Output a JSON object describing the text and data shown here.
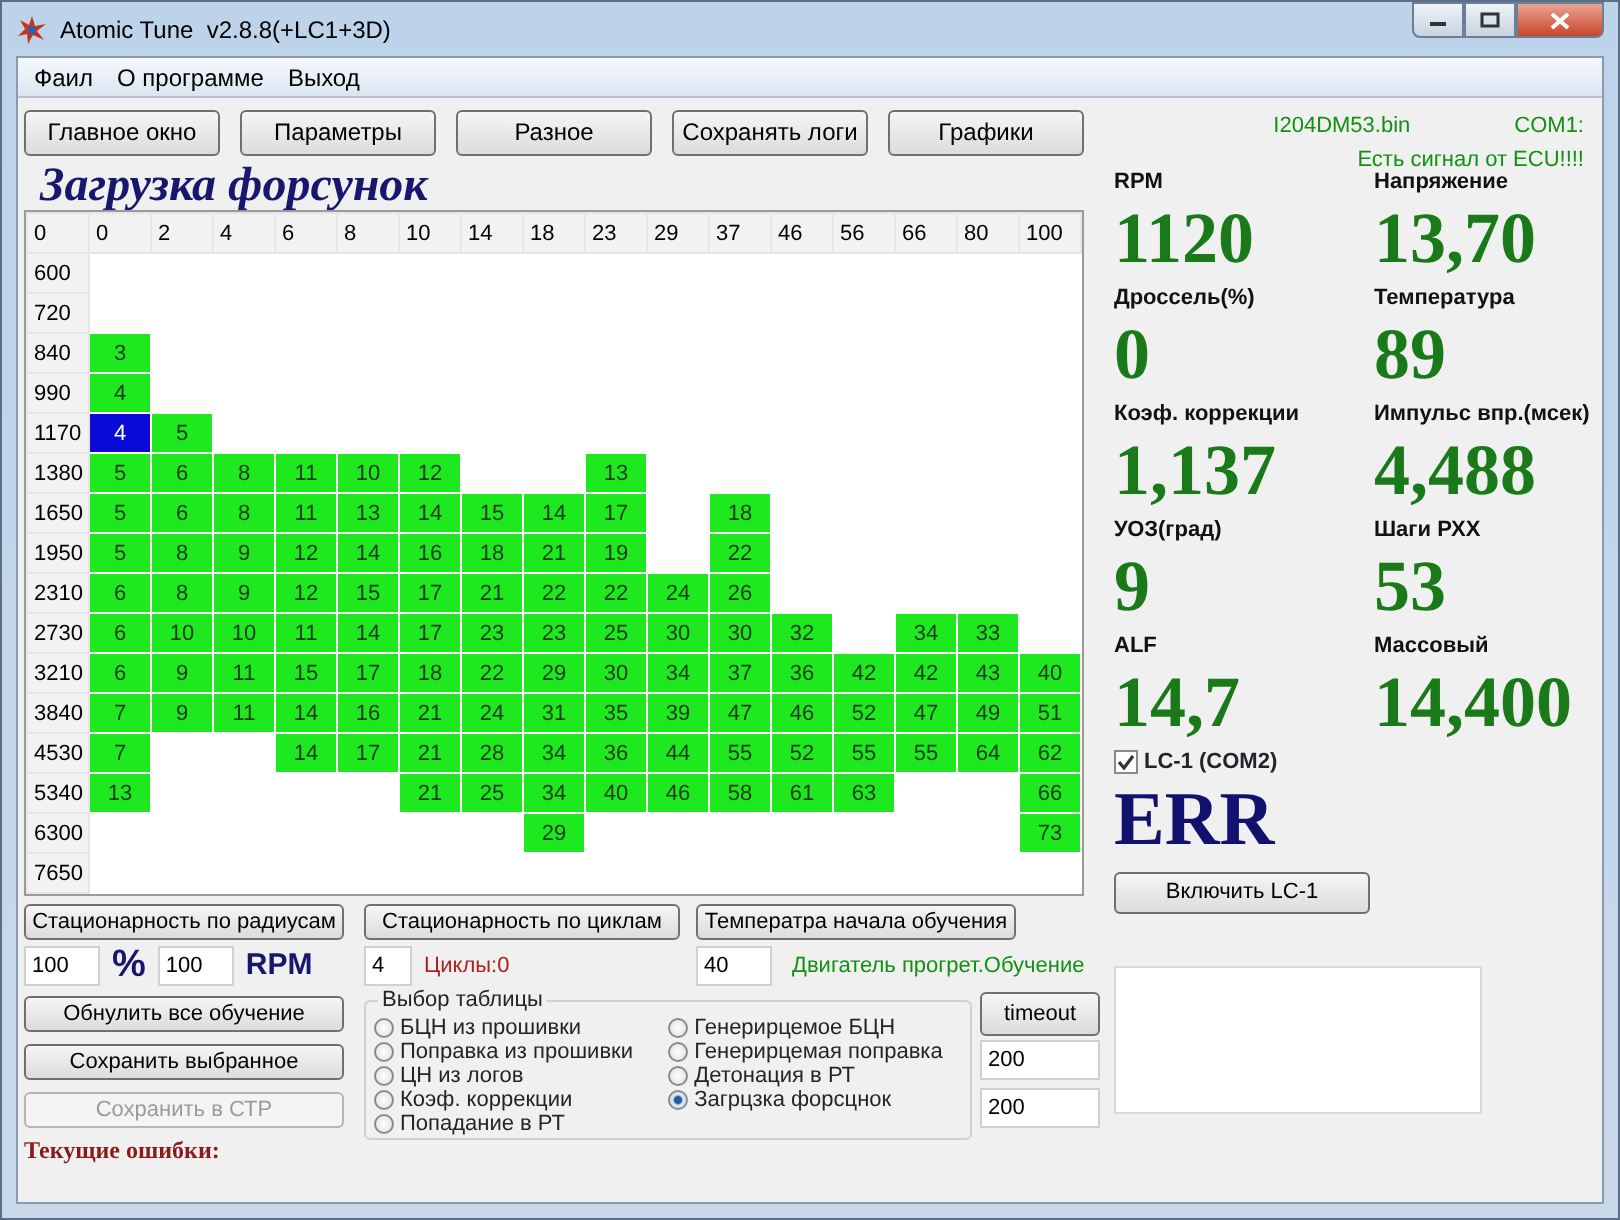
{
  "window": {
    "title": "Atomic Tune  v2.8.8(+LC1+3D)"
  },
  "menu": [
    "Фаил",
    "О программе",
    "Выход"
  ],
  "toolbar": [
    "Главное окно",
    "Параметры",
    "Разное",
    "Сохранять логи",
    "Графики"
  ],
  "file_name": "I204DM53.bin",
  "port": "COM1:",
  "signal_status": "Есть сигнал от ECU!!!!",
  "heading": "Загрузка форсунок",
  "table": {
    "corner": "0",
    "columns": [
      "0",
      "2",
      "4",
      "6",
      "8",
      "10",
      "14",
      "18",
      "23",
      "29",
      "37",
      "46",
      "56",
      "66",
      "80",
      "100"
    ],
    "rows": [
      {
        "rpm": "600",
        "cells": [
          null,
          null,
          null,
          null,
          null,
          null,
          null,
          null,
          null,
          null,
          null,
          null,
          null,
          null,
          null,
          null
        ]
      },
      {
        "rpm": "720",
        "cells": [
          null,
          null,
          null,
          null,
          null,
          null,
          null,
          null,
          null,
          null,
          null,
          null,
          null,
          null,
          null,
          null
        ]
      },
      {
        "rpm": "840",
        "cells": [
          {
            "v": "3",
            "selected": false
          },
          null,
          null,
          null,
          null,
          null,
          null,
          null,
          null,
          null,
          null,
          null,
          null,
          null,
          null,
          null
        ]
      },
      {
        "rpm": "990",
        "cells": [
          {
            "v": "4",
            "selected": false
          },
          null,
          null,
          null,
          null,
          null,
          null,
          null,
          null,
          null,
          null,
          null,
          null,
          null,
          null,
          null
        ]
      },
      {
        "rpm": "1170",
        "cells": [
          {
            "v": "4",
            "selected": true
          },
          {
            "v": "5",
            "selected": false
          },
          null,
          null,
          null,
          null,
          null,
          null,
          null,
          null,
          null,
          null,
          null,
          null,
          null,
          null
        ]
      },
      {
        "rpm": "1380",
        "cells": [
          {
            "v": "5",
            "selected": false
          },
          {
            "v": "6",
            "selected": false
          },
          {
            "v": "8",
            "selected": false
          },
          {
            "v": "11",
            "selected": false
          },
          {
            "v": "10",
            "selected": false
          },
          {
            "v": "12",
            "selected": false
          },
          null,
          null,
          {
            "v": "13",
            "selected": false
          },
          null,
          null,
          null,
          null,
          null,
          null,
          null
        ]
      },
      {
        "rpm": "1650",
        "cells": [
          {
            "v": "5",
            "selected": false
          },
          {
            "v": "6",
            "selected": false
          },
          {
            "v": "8",
            "selected": false
          },
          {
            "v": "11",
            "selected": false
          },
          {
            "v": "13",
            "selected": false
          },
          {
            "v": "14",
            "selected": false
          },
          {
            "v": "15",
            "selected": false
          },
          {
            "v": "14",
            "selected": false
          },
          {
            "v": "17",
            "selected": false
          },
          null,
          {
            "v": "18",
            "selected": false
          },
          null,
          null,
          null,
          null,
          null
        ]
      },
      {
        "rpm": "1950",
        "cells": [
          {
            "v": "5",
            "selected": false
          },
          {
            "v": "8",
            "selected": false
          },
          {
            "v": "9",
            "selected": false
          },
          {
            "v": "12",
            "selected": false
          },
          {
            "v": "14",
            "selected": false
          },
          {
            "v": "16",
            "selected": false
          },
          {
            "v": "18",
            "selected": false
          },
          {
            "v": "21",
            "selected": false
          },
          {
            "v": "19",
            "selected": false
          },
          null,
          {
            "v": "22",
            "selected": false
          },
          null,
          null,
          null,
          null,
          null
        ]
      },
      {
        "rpm": "2310",
        "cells": [
          {
            "v": "6",
            "selected": false
          },
          {
            "v": "8",
            "selected": false
          },
          {
            "v": "9",
            "selected": false
          },
          {
            "v": "12",
            "selected": false
          },
          {
            "v": "15",
            "selected": false
          },
          {
            "v": "17",
            "selected": false
          },
          {
            "v": "21",
            "selected": false
          },
          {
            "v": "22",
            "selected": false
          },
          {
            "v": "22",
            "selected": false
          },
          {
            "v": "24",
            "selected": false
          },
          {
            "v": "26",
            "selected": false
          },
          null,
          null,
          null,
          null,
          null
        ]
      },
      {
        "rpm": "2730",
        "cells": [
          {
            "v": "6",
            "selected": false
          },
          {
            "v": "10",
            "selected": false
          },
          {
            "v": "10",
            "selected": false
          },
          {
            "v": "11",
            "selected": false
          },
          {
            "v": "14",
            "selected": false
          },
          {
            "v": "17",
            "selected": false
          },
          {
            "v": "23",
            "selected": false
          },
          {
            "v": "23",
            "selected": false
          },
          {
            "v": "25",
            "selected": false
          },
          {
            "v": "30",
            "selected": false
          },
          {
            "v": "30",
            "selected": false
          },
          {
            "v": "32",
            "selected": false
          },
          null,
          {
            "v": "34",
            "selected": false
          },
          {
            "v": "33",
            "selected": false
          },
          null
        ]
      },
      {
        "rpm": "3210",
        "cells": [
          {
            "v": "6",
            "selected": false
          },
          {
            "v": "9",
            "selected": false
          },
          {
            "v": "11",
            "selected": false
          },
          {
            "v": "15",
            "selected": false
          },
          {
            "v": "17",
            "selected": false
          },
          {
            "v": "18",
            "selected": false
          },
          {
            "v": "22",
            "selected": false
          },
          {
            "v": "29",
            "selected": false
          },
          {
            "v": "30",
            "selected": false
          },
          {
            "v": "34",
            "selected": false
          },
          {
            "v": "37",
            "selected": false
          },
          {
            "v": "36",
            "selected": false
          },
          {
            "v": "42",
            "selected": false
          },
          {
            "v": "42",
            "selected": false
          },
          {
            "v": "43",
            "selected": false
          },
          {
            "v": "40",
            "selected": false
          }
        ]
      },
      {
        "rpm": "3840",
        "cells": [
          {
            "v": "7",
            "selected": false
          },
          {
            "v": "9",
            "selected": false
          },
          {
            "v": "11",
            "selected": false
          },
          {
            "v": "14",
            "selected": false
          },
          {
            "v": "16",
            "selected": false
          },
          {
            "v": "21",
            "selected": false
          },
          {
            "v": "24",
            "selected": false
          },
          {
            "v": "31",
            "selected": false
          },
          {
            "v": "35",
            "selected": false
          },
          {
            "v": "39",
            "selected": false
          },
          {
            "v": "47",
            "selected": false
          },
          {
            "v": "46",
            "selected": false
          },
          {
            "v": "52",
            "selected": false
          },
          {
            "v": "47",
            "selected": false
          },
          {
            "v": "49",
            "selected": false
          },
          {
            "v": "51",
            "selected": false
          }
        ]
      },
      {
        "rpm": "4530",
        "cells": [
          {
            "v": "7",
            "selected": false
          },
          null,
          null,
          {
            "v": "14",
            "selected": false
          },
          {
            "v": "17",
            "selected": false
          },
          {
            "v": "21",
            "selected": false
          },
          {
            "v": "28",
            "selected": false
          },
          {
            "v": "34",
            "selected": false
          },
          {
            "v": "36",
            "selected": false
          },
          {
            "v": "44",
            "selected": false
          },
          {
            "v": "55",
            "selected": false
          },
          {
            "v": "52",
            "selected": false
          },
          {
            "v": "55",
            "selected": false
          },
          {
            "v": "55",
            "selected": false
          },
          {
            "v": "64",
            "selected": false
          },
          {
            "v": "62",
            "selected": false
          }
        ]
      },
      {
        "rpm": "5340",
        "cells": [
          {
            "v": "13",
            "selected": false
          },
          null,
          null,
          null,
          null,
          {
            "v": "21",
            "selected": false
          },
          {
            "v": "25",
            "selected": false
          },
          {
            "v": "34",
            "selected": false
          },
          {
            "v": "40",
            "selected": false
          },
          {
            "v": "46",
            "selected": false
          },
          {
            "v": "58",
            "selected": false
          },
          {
            "v": "61",
            "selected": false
          },
          {
            "v": "63",
            "selected": false
          },
          null,
          null,
          {
            "v": "66",
            "selected": false
          }
        ]
      },
      {
        "rpm": "6300",
        "cells": [
          null,
          null,
          null,
          null,
          null,
          null,
          null,
          {
            "v": "29",
            "selected": false
          },
          null,
          null,
          null,
          null,
          null,
          null,
          null,
          {
            "v": "73",
            "selected": false
          }
        ]
      },
      {
        "rpm": "7650",
        "cells": [
          null,
          null,
          null,
          null,
          null,
          null,
          null,
          null,
          null,
          null,
          null,
          null,
          null,
          null,
          null,
          null
        ]
      }
    ]
  },
  "metrics": [
    {
      "label": "RPM",
      "value": "1120"
    },
    {
      "label": "Напряжение",
      "value": "13,70"
    },
    {
      "label": "Дроссель(%)",
      "value": "0"
    },
    {
      "label": "Температура",
      "value": "89"
    },
    {
      "label": "Коэф. коррекции",
      "value": "1,137"
    },
    {
      "label": "Импульс впр.(мсек)",
      "value": "4,488"
    },
    {
      "label": "УОЗ(град)",
      "value": "9"
    },
    {
      "label": "Шаги РХХ",
      "value": "53"
    },
    {
      "label": "ALF",
      "value": "14,7"
    },
    {
      "label": "Массовый",
      "value": "14,400"
    }
  ],
  "lc1": {
    "label": "LC-1 (COM2)",
    "checked": true,
    "value": "ERR",
    "button": "Включить LC-1"
  },
  "stationarity_radius": {
    "button": "Стационарность по радиусам",
    "percent": "100",
    "percent_unit": "%",
    "rpm": "100",
    "rpm_unit": "RPM"
  },
  "stationarity_cycles": {
    "button": "Стационарность по циклам",
    "value": "4",
    "status": "Циклы:0"
  },
  "learn_temperature": {
    "button": "Температра начала обучения",
    "value": "40",
    "status": "Двигатель прогрет.Обучение"
  },
  "actions": [
    {
      "label": "Обнулить все обучение",
      "disabled": false
    },
    {
      "label": "Сохранить выбранное",
      "disabled": false
    },
    {
      "label": "Сохранить в СТР",
      "disabled": true
    }
  ],
  "table_choice": {
    "title": "Выбор таблицы",
    "options": [
      {
        "label": "БЦН из прошивки",
        "selected": false
      },
      {
        "label": "Поправка из прошивки",
        "selected": false
      },
      {
        "label": "ЦН из логов",
        "selected": false
      },
      {
        "label": "Коэф. коррекции",
        "selected": false
      },
      {
        "label": "Попадание в РТ",
        "selected": false
      },
      {
        "label": "Генерирцемое БЦН",
        "selected": false
      },
      {
        "label": "Генерирцемая поправка",
        "selected": false
      },
      {
        "label": "Детонация в РТ",
        "selected": false
      },
      {
        "label": "Загрцзка форсцнок",
        "selected": true
      }
    ]
  },
  "timeout": {
    "button": "timeout",
    "fields": [
      "200",
      "200"
    ]
  },
  "errors_label": "Текущие ошибки:"
}
